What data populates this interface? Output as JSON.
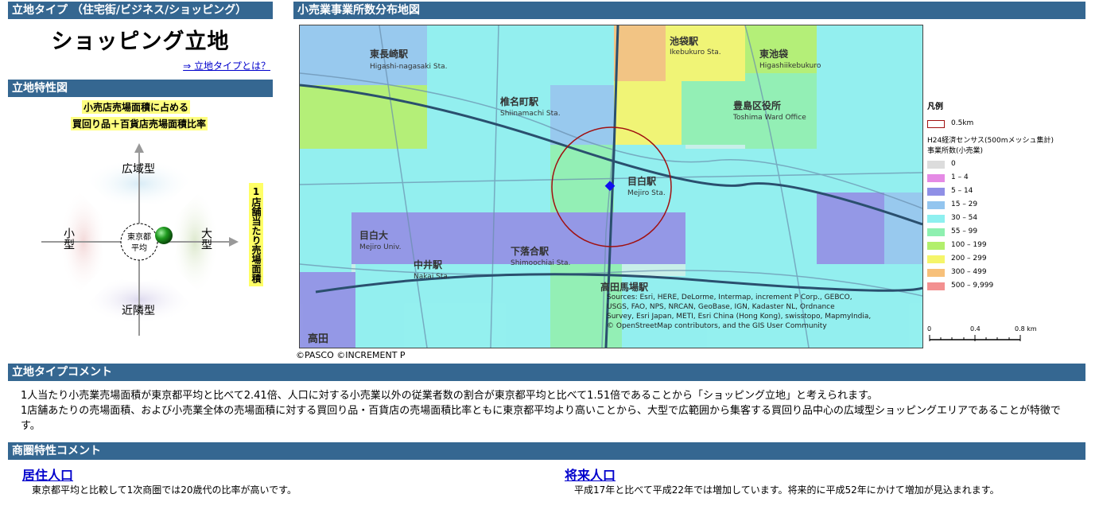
{
  "type_section": {
    "header": "立地タイプ （住宅街/ビジネス/ショッピング）",
    "type_name": "ショッピング立地",
    "link_text": "⇒ 立地タイプとは？"
  },
  "char_section": {
    "header": "立地特性図",
    "ratio_label_line1": "小売店売場面積に占める",
    "ratio_label_line2": "買回り品＋百貨店売場面積比率",
    "vertical_axis_label": "1店舗当たり売場面積",
    "top_label": "広域型",
    "bottom_label": "近隣型",
    "left_label": "小型",
    "right_label": "大型",
    "center_label_line1": "東京都",
    "center_label_line2": "平均"
  },
  "map_section": {
    "header": "小売業事業所数分布地図",
    "copyright": "©PASCO ©INCREMENT P",
    "attribution_line1": "Sources: Esri, HERE, DeLorme, Intermap, increment P Corp., GEBCO,",
    "attribution_line2": "USGS, FAO, NPS, NRCAN, GeoBase, IGN, Kadaster NL, Ordnance",
    "attribution_line3": "Survey, Esri Japan, METI, Esri China (Hong Kong), swisstopo, MapmyIndia,",
    "attribution_line4": "© OpenStreetMap contributors, and the GIS User Community",
    "stations": [
      {
        "name": "東長崎駅",
        "romaji": "Higashi-nagasaki Sta."
      },
      {
        "name": "池袋駅",
        "romaji": "Ikebukuro Sta."
      },
      {
        "name": "椎名町駅",
        "romaji": "Shiinamachi Sta."
      },
      {
        "name": "目白駅",
        "romaji": "Mejiro Sta."
      },
      {
        "name": "下落合駅",
        "romaji": "Shimoochiai Sta."
      },
      {
        "name": "中井駅",
        "romaji": "Nakai Sta."
      },
      {
        "name": "高田馬場駅",
        "romaji": ""
      },
      {
        "name": "東池袋",
        "romaji": "Higashiikebukuro"
      },
      {
        "name": "豊島区役所",
        "romaji": "Toshima Ward Office"
      },
      {
        "name": "目白大",
        "romaji": "Mejiro Univ."
      },
      {
        "name": "高田",
        "romaji": ""
      }
    ],
    "legend": {
      "title": "凡例",
      "circle_label": "0.5km",
      "census_label": "H24経済センサス(500mメッシュ集計)",
      "count_label": "事業所数(小売業)",
      "items": [
        {
          "range": "0",
          "color": "#dcdcdc"
        },
        {
          "range": "1 – 4",
          "color": "#e58ae5"
        },
        {
          "range": "5 – 14",
          "color": "#8f8fe6"
        },
        {
          "range": "15 – 29",
          "color": "#93c5ef"
        },
        {
          "range": "30 – 54",
          "color": "#8ef0f0"
        },
        {
          "range": "55 – 99",
          "color": "#8ef0b0"
        },
        {
          "range": "100 – 199",
          "color": "#b2ef6c"
        },
        {
          "range": "200 – 299",
          "color": "#f5f56a"
        },
        {
          "range": "300 – 499",
          "color": "#f7c07a"
        },
        {
          "range": "500 – 9,999",
          "color": "#f39090"
        }
      ],
      "scale_ticks": [
        "0",
        "0.4",
        "0.8 km"
      ]
    }
  },
  "type_comment": {
    "header": "立地タイプコメント",
    "line1": "1人当たり小売業売場面積が東京都平均と比べて2.41倍、人口に対する小売業以外の従業者数の割合が東京都平均と比べて1.51倍であることから「ショッピング立地」と考えられます。",
    "line2": "1店舗あたりの売場面積、および小売業全体の売場面積に対する買回り品・百貨店の売場面積比率ともに東京都平均より高いことから、大型で広範囲から集客する買回り品中心の広域型ショッピングエリアであることが特徴です。"
  },
  "area_comment": {
    "header": "商圏特性コメント",
    "resident_title": "居住人口",
    "resident_text": "東京都平均と比較して1次商圏では20歳代の比率が高いです。",
    "future_title": "将来人口",
    "future_text": "平成17年と比べて平成22年では増加しています。将来的に平成52年にかけて増加が見込まれます。"
  }
}
